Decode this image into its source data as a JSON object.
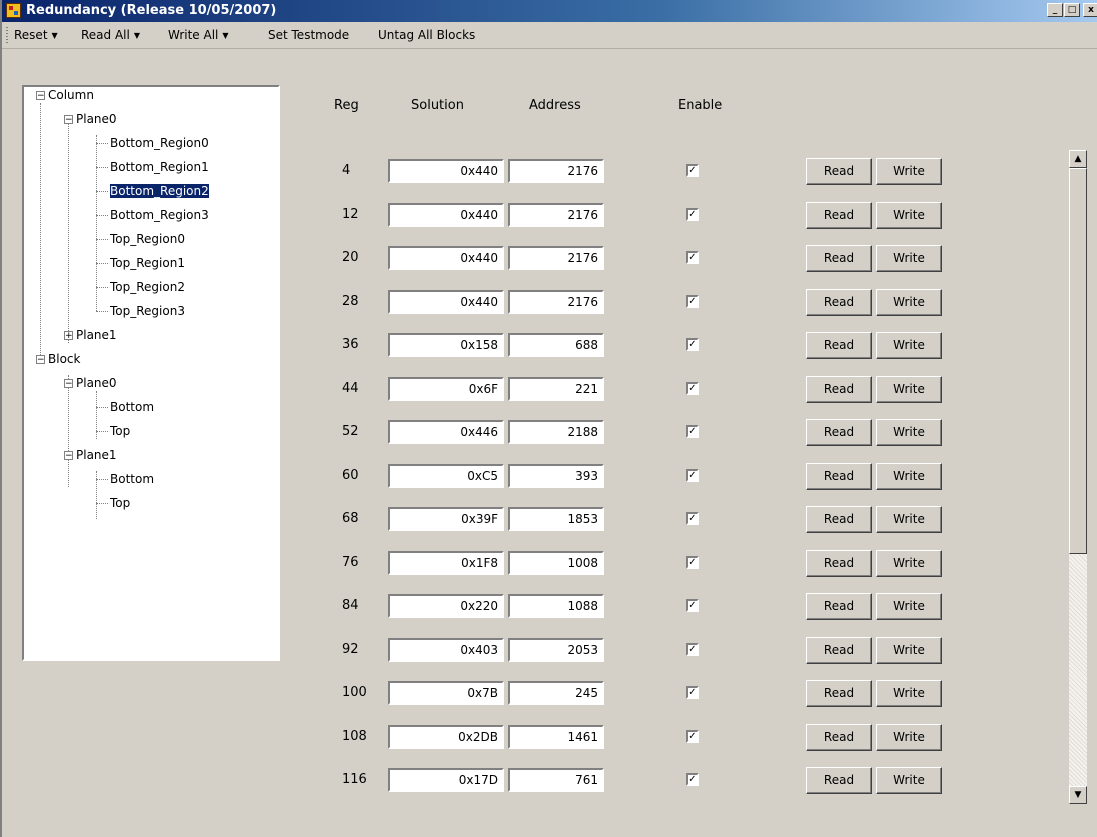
{
  "window": {
    "title": "Redundancy  (Release 10/05/2007)",
    "controls": {
      "minimize": "_",
      "maximize": "□",
      "close": "x"
    }
  },
  "menu": [
    {
      "label": "Reset",
      "dropdown": true
    },
    {
      "label": "Read All",
      "dropdown": true
    },
    {
      "label": "Write All",
      "dropdown": true
    },
    {
      "label": "Set Testmode",
      "dropdown": false
    },
    {
      "label": "Untag All Blocks",
      "dropdown": false
    }
  ],
  "tree": {
    "column": "Column",
    "column_plane0": "Plane0",
    "leaves_plane0": [
      "Bottom_Region0",
      "Bottom_Region1",
      "Bottom_Region2",
      "Bottom_Region3",
      "Top_Region0",
      "Top_Region1",
      "Top_Region2",
      "Top_Region3"
    ],
    "selected": "Bottom_Region2",
    "column_plane1": "Plane1",
    "block": "Block",
    "block_plane0": "Plane0",
    "block_plane0_bottom": "Bottom",
    "block_plane0_top": "Top",
    "block_plane1": "Plane1",
    "block_plane1_bottom": "Bottom",
    "block_plane1_top": "Top"
  },
  "headers": {
    "reg": "Reg",
    "solution": "Solution",
    "address": "Address",
    "enable": "Enable"
  },
  "buttons": {
    "read": "Read",
    "write": "Write"
  },
  "rows": [
    {
      "reg": "4",
      "solution": "0x440",
      "address": "2176",
      "enabled": true
    },
    {
      "reg": "12",
      "solution": "0x440",
      "address": "2176",
      "enabled": true
    },
    {
      "reg": "20",
      "solution": "0x440",
      "address": "2176",
      "enabled": true
    },
    {
      "reg": "28",
      "solution": "0x440",
      "address": "2176",
      "enabled": true
    },
    {
      "reg": "36",
      "solution": "0x158",
      "address": "688",
      "enabled": true
    },
    {
      "reg": "44",
      "solution": "0x6F",
      "address": "221",
      "enabled": true
    },
    {
      "reg": "52",
      "solution": "0x446",
      "address": "2188",
      "enabled": true
    },
    {
      "reg": "60",
      "solution": "0xC5",
      "address": "393",
      "enabled": true
    },
    {
      "reg": "68",
      "solution": "0x39F",
      "address": "1853",
      "enabled": true
    },
    {
      "reg": "76",
      "solution": "0x1F8",
      "address": "1008",
      "enabled": true
    },
    {
      "reg": "84",
      "solution": "0x220",
      "address": "1088",
      "enabled": true
    },
    {
      "reg": "92",
      "solution": "0x403",
      "address": "2053",
      "enabled": true
    },
    {
      "reg": "100",
      "solution": "0x7B",
      "address": "245",
      "enabled": true
    },
    {
      "reg": "108",
      "solution": "0x2DB",
      "address": "1461",
      "enabled": true
    },
    {
      "reg": "116",
      "solution": "0x17D",
      "address": "761",
      "enabled": true
    }
  ],
  "scrollbar": {
    "up_glyph": "▲",
    "down_glyph": "▼"
  }
}
